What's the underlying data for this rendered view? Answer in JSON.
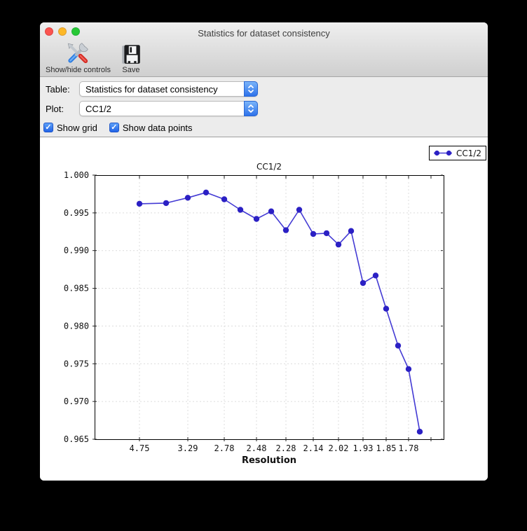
{
  "window": {
    "title": "Statistics for dataset consistency",
    "traffic_lights": [
      "close",
      "minimize",
      "zoom"
    ]
  },
  "colors": {
    "traffic_red": "#fb5450",
    "traffic_yellow": "#fdb827",
    "traffic_green": "#27c835",
    "mac_accent_blue": "#2e72ea",
    "panel_gray": "#ececec",
    "chart_line": "#443bd4",
    "chart_marker": "#2b20c4"
  },
  "icons": {
    "show_hide_controls": "tools-icon",
    "save": "save-icon",
    "popup": "up-down-chevrons-icon",
    "checkbox": "check-icon"
  },
  "toolbar": {
    "buttons": [
      {
        "label": "Show/hide controls",
        "icon": "tools-icon"
      },
      {
        "label": "Save",
        "icon": "save-icon"
      }
    ]
  },
  "controls": {
    "table_label": "Table:",
    "table_value": "Statistics for dataset consistency",
    "plot_label": "Plot:",
    "plot_value": "CC1/2",
    "check_glyph": "✓",
    "checkboxes": [
      {
        "label": "Show grid",
        "checked": true
      },
      {
        "label": "Show data points",
        "checked": true
      }
    ]
  },
  "chart_data": {
    "type": "line",
    "title": "CC1/2",
    "xlabel": "Resolution",
    "ylabel": "",
    "ylim": [
      0.965,
      1.0
    ],
    "grid": true,
    "show_markers": true,
    "legend": {
      "label": "CC1/2",
      "position": "top-right"
    },
    "y_ticks": [
      {
        "label": "1.000",
        "value": 1.0
      },
      {
        "label": "0.995",
        "value": 0.995
      },
      {
        "label": "0.990",
        "value": 0.99
      },
      {
        "label": "0.985",
        "value": 0.985
      },
      {
        "label": "0.980",
        "value": 0.98
      },
      {
        "label": "0.975",
        "value": 0.975
      },
      {
        "label": "0.970",
        "value": 0.97
      },
      {
        "label": "0.965",
        "value": 0.965
      }
    ],
    "x_ticks": [
      {
        "label": "4.75",
        "frac": 0.1285
      },
      {
        "label": "3.29",
        "frac": 0.2671
      },
      {
        "label": "2.78",
        "frac": 0.3714
      },
      {
        "label": "2.48",
        "frac": 0.4639
      },
      {
        "label": "2.28",
        "frac": 0.5482
      },
      {
        "label": "2.14",
        "frac": 0.6265
      },
      {
        "label": "2.02",
        "frac": 0.6988
      },
      {
        "label": "1.93",
        "frac": 0.7691
      },
      {
        "label": "1.85",
        "frac": 0.8353
      },
      {
        "label": "1.78",
        "frac": 0.8996
      }
    ],
    "unlabeled_tick_fracs": [
      0.9639
    ],
    "series": [
      {
        "name": "CC1/2",
        "line_color": "#443bd4",
        "marker_color": "#2b20c4",
        "x_frac": [
          0.1285,
          0.2048,
          0.2671,
          0.3193,
          0.3714,
          0.4177,
          0.4639,
          0.506,
          0.5482,
          0.5863,
          0.6265,
          0.6647,
          0.6988,
          0.7349,
          0.7691,
          0.8052,
          0.8353,
          0.8695,
          0.8996,
          0.9317
        ],
        "values": [
          0.9962,
          0.9963,
          0.997,
          0.9977,
          0.9968,
          0.9954,
          0.9942,
          0.9952,
          0.9927,
          0.9954,
          0.9922,
          0.9923,
          0.9908,
          0.9926,
          0.9857,
          0.9867,
          0.9823,
          0.9774,
          0.9743,
          0.966
        ]
      }
    ]
  }
}
